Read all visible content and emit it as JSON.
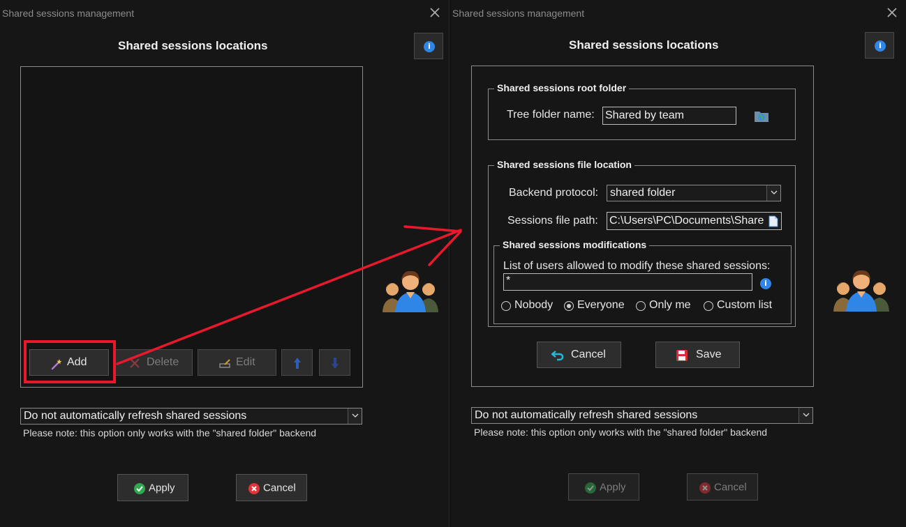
{
  "left": {
    "window_title": "Shared sessions management",
    "heading": "Shared sessions locations",
    "buttons": {
      "add": "Add",
      "delete": "Delete",
      "edit": "Edit"
    },
    "refresh_select": {
      "selected": "Do not automatically refresh shared sessions"
    },
    "note": "Please note: this option only works with the \"shared folder\" backend",
    "apply": "Apply",
    "cancel": "Cancel"
  },
  "right": {
    "window_title": "Shared sessions management",
    "heading": "Shared sessions locations",
    "root_folder": {
      "legend": "Shared sessions root folder",
      "label": "Tree folder name:",
      "value": "Shared by team"
    },
    "file_location": {
      "legend": "Shared sessions file location",
      "backend_label": "Backend protocol:",
      "backend_value": "shared folder",
      "path_label": "Sessions file path:",
      "path_value": "C:\\Users\\PC\\Documents\\Share"
    },
    "modifications": {
      "legend": "Shared sessions modifications",
      "users_label": "List of users allowed to modify these shared sessions:",
      "users_value": "*",
      "options": [
        "Nobody",
        "Everyone",
        "Only me",
        "Custom list"
      ],
      "selected": "Everyone"
    },
    "form_cancel": "Cancel",
    "form_save": "Save",
    "refresh_select": {
      "selected": "Do not automatically refresh shared sessions"
    },
    "note": "Please note: this option only works with the \"shared folder\" backend",
    "apply": "Apply",
    "cancel": "Cancel"
  },
  "icons": [
    "close-icon",
    "info-icon",
    "magic-wand-icon",
    "delete-x-icon",
    "edit-icon",
    "arrow-up-icon",
    "arrow-down-icon",
    "chevron-down-icon",
    "check-icon",
    "cancel-icon",
    "globe-folder-icon",
    "file-icon",
    "undo-icon",
    "floppy-disk-icon",
    "users-group-icon"
  ],
  "colors": {
    "background": "#161616",
    "accent_blue": "#2f86e6",
    "annotation_red": "#e8192c",
    "apply_green": "#2fa84f",
    "cancel_red": "#e0343a"
  }
}
